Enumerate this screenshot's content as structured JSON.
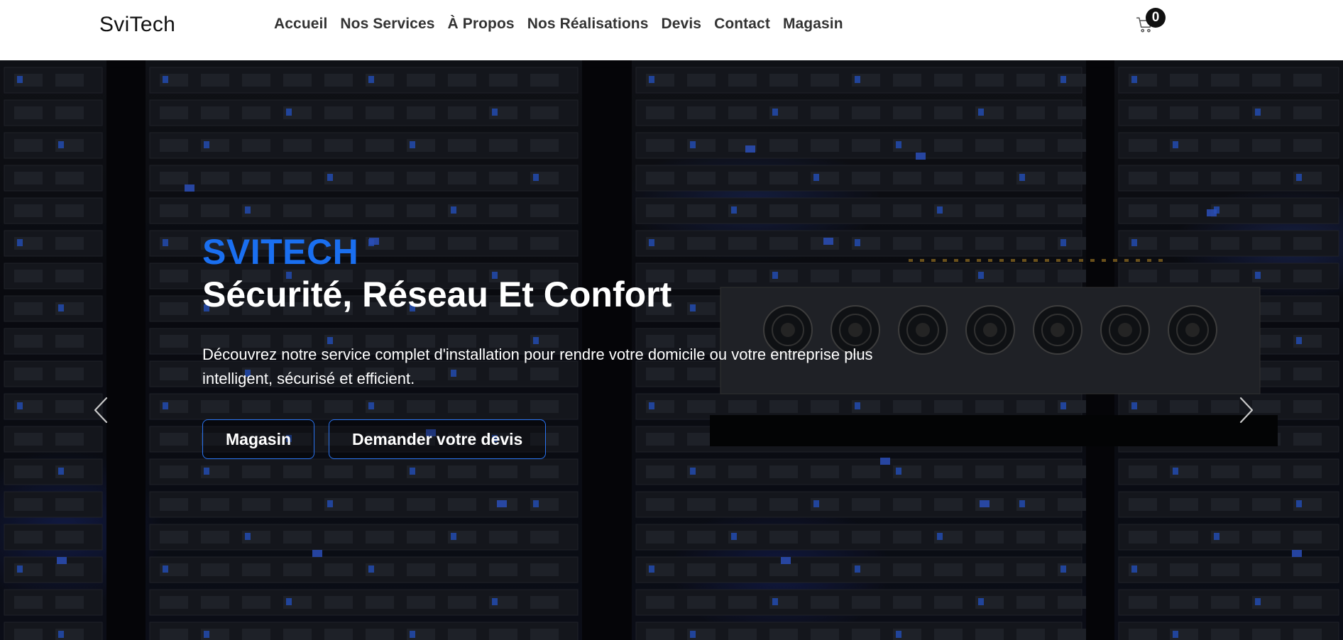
{
  "navbar": {
    "brand": "SviTech",
    "links": [
      "Accueil",
      "Nos Services",
      "À Propos",
      "Nos Réalisations",
      "Devis",
      "Contact",
      "Magasin"
    ],
    "cart": {
      "icon": "cart-icon",
      "count": "0"
    }
  },
  "hero": {
    "kicker": "SVITECH",
    "headline": "Sécurité, Réseau Et Confort",
    "lead": "Découvrez notre service complet d'installation pour rendre votre domicile ou votre entreprise plus intelligent, sécurisé et efficient.",
    "buttons": {
      "shop": "Magasin",
      "quote": "Demander votre devis"
    },
    "controls": {
      "prev_icon": "chevron-left-icon",
      "next_icon": "chevron-right-icon"
    }
  },
  "colors": {
    "accent": "#1a6ff0",
    "navbar_bg": "#ffffff",
    "hero_text": "#ffffff",
    "button_border": "#2a74f2"
  }
}
